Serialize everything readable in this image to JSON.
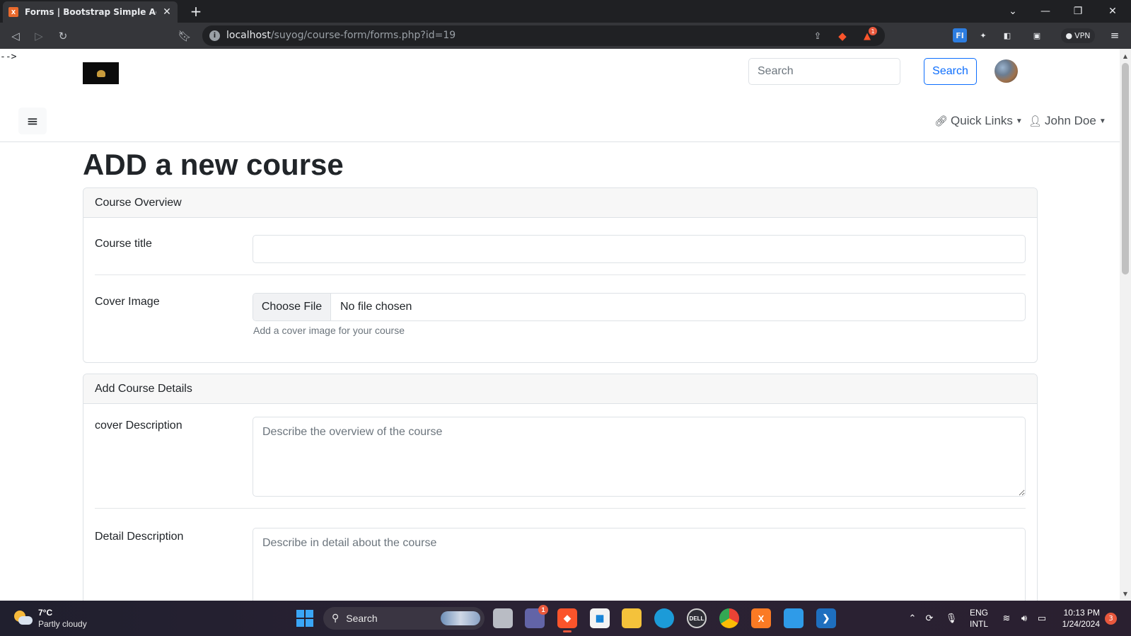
{
  "browser": {
    "tab_title": "Forms | Bootstrap Simple Admin",
    "url_host": "localhost",
    "url_path": "/suyog/course-form/forms.php?id=19",
    "vpn_label": "VPN",
    "brave_badge": "1"
  },
  "page": {
    "comment_artifact": "-->",
    "header": {
      "search_placeholder": "Search",
      "search_button": "Search"
    },
    "nav": {
      "quick_links": "Quick Links",
      "user_name": "John Doe"
    },
    "title": "ADD a new course",
    "overview_card": {
      "header": "Course Overview",
      "course_title_label": "Course title",
      "course_title_value": "",
      "cover_image_label": "Cover Image",
      "choose_file_label": "Choose File",
      "file_status": "No file chosen",
      "cover_help": "Add a cover image for your course"
    },
    "details_card": {
      "header": "Add Course Details",
      "cover_description_label": "cover Description",
      "cover_description_placeholder": "Describe the overview of the course",
      "detail_description_label": "Detail Description",
      "detail_description_placeholder": "Describe in detail about the course"
    }
  },
  "taskbar": {
    "weather_temp": "7°C",
    "weather_desc": "Partly cloudy",
    "search_label": "Search",
    "teams_badge": "1",
    "lang_top": "ENG",
    "lang_bottom": "INTL",
    "time": "10:13 PM",
    "date": "1/24/2024",
    "notification_count": "3"
  },
  "colors": {
    "primary": "#0d6efd",
    "taskbar_accent": "#e8583d",
    "tab_favicon": "#e96a2d"
  }
}
